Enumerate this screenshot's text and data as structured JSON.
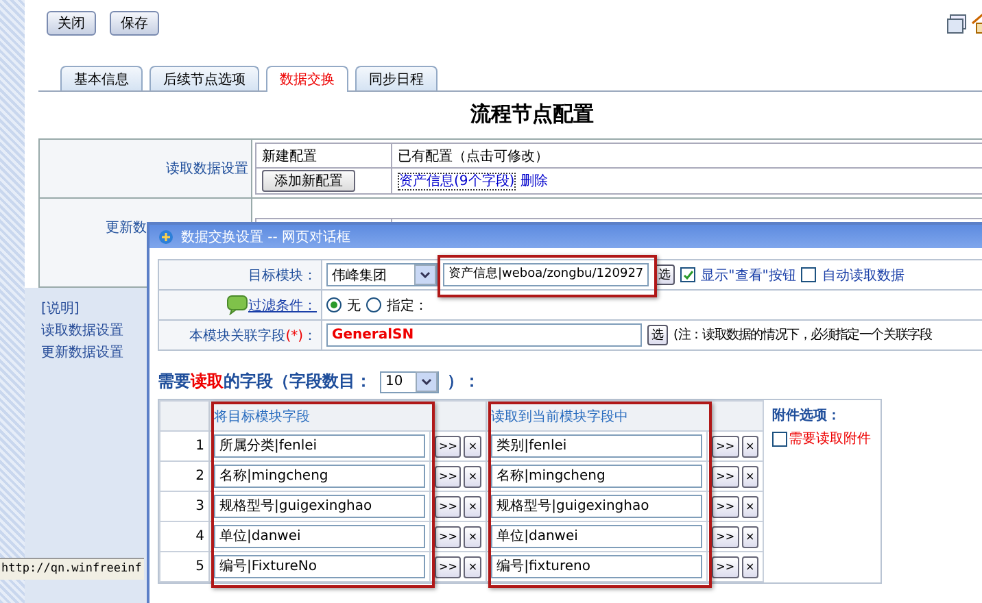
{
  "page": {
    "buttons": [
      "关闭",
      "保存"
    ],
    "tabs": [
      {
        "label": "基本信息",
        "selected": false
      },
      {
        "label": "后续节点选项",
        "selected": false
      },
      {
        "label": "数据交换",
        "selected": true
      },
      {
        "label": "同步日程",
        "selected": false
      }
    ],
    "title": "流程节点配置",
    "config_sections": [
      {
        "label": "读取数据设置",
        "new_header": "新建配置",
        "existing_header": "已有配置（点击可修改）",
        "add_button": "添加新配置",
        "existing_link": "资产信息(9个字段)",
        "delete_link": "删除"
      },
      {
        "label": "更新数"
      }
    ],
    "links": [
      "[说明]",
      "读取数据设置",
      "更新数据设置"
    ]
  },
  "status_bar": {
    "url": "http://qn.winfreeinf"
  },
  "dialog": {
    "title": "数据交换设置 -- 网页对话框",
    "target_module": {
      "label": "目标模块：",
      "group": "伟峰集团",
      "module": "资产信息|weboa/zongbu/120927",
      "pick_button": "选",
      "options": [
        {
          "label": "显示\"查看\"按钮",
          "checked": true
        },
        {
          "label": "自动读取数据",
          "checked": false
        }
      ]
    },
    "filter": {
      "label": "过滤条件：",
      "options": [
        {
          "label": "无",
          "selected": true
        },
        {
          "label": "指定：",
          "selected": false
        }
      ]
    },
    "link_field": {
      "label": "本模块关联字段",
      "required_mark": "(*)",
      "colon": "：",
      "value": "GeneralSN",
      "pick_button": "选",
      "note": "(注：读取数据的情况下，必须指定一个关联字段"
    },
    "fields_heading": {
      "prefix": "需要",
      "highlight": "读取",
      "suffix": "的字段（字段数目：",
      "count": "10",
      "end": "）："
    },
    "fields_table": {
      "columns": [
        "将目标模块字段",
        "读取到当前模块字段中"
      ],
      "rows": [
        {
          "index": "1",
          "source": "所属分类|fenlei",
          "target": "类别|fenlei"
        },
        {
          "index": "2",
          "source": "名称|mingcheng",
          "target": "名称|mingcheng"
        },
        {
          "index": "3",
          "source": "规格型号|guigexinghao",
          "target": "规格型号|guigexinghao"
        },
        {
          "index": "4",
          "source": "单位|danwei",
          "target": "单位|danwei"
        },
        {
          "index": "5",
          "source": "编号|FixtureNo",
          "target": "编号|fixtureno"
        }
      ],
      "move_button": ">>",
      "clear_button": "×"
    },
    "attachments": {
      "heading": "附件选项：",
      "option": {
        "label": "需要读取附件",
        "checked": false
      }
    }
  }
}
